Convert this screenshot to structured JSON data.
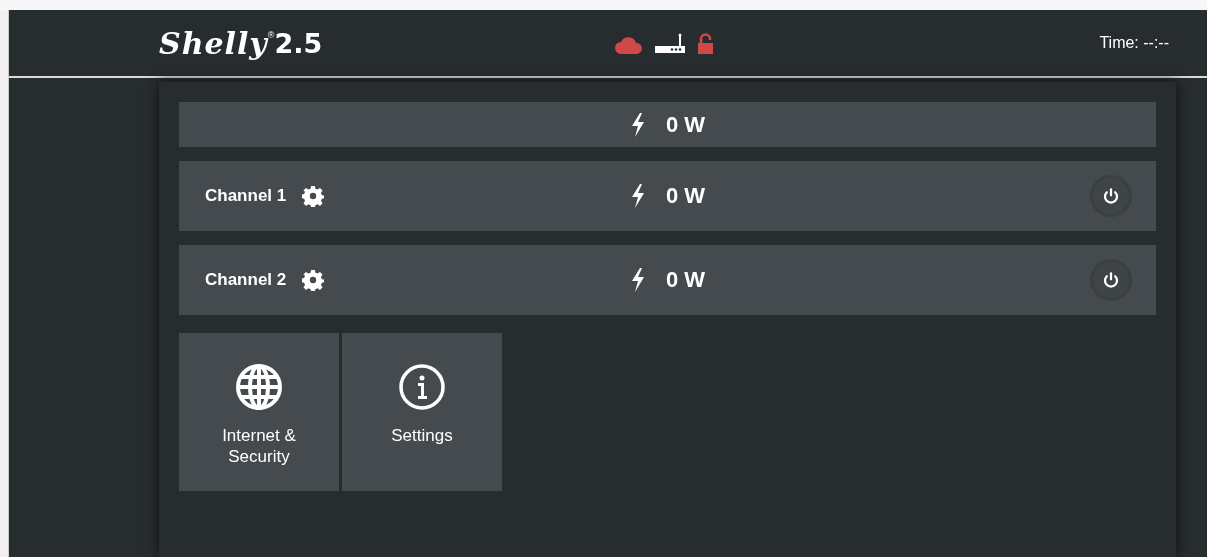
{
  "header": {
    "logo": {
      "brand": "Shelly",
      "mark": "®",
      "model": "2.5"
    },
    "status_icons": [
      {
        "kind": "cloud",
        "on": false
      },
      {
        "kind": "router",
        "on": true
      },
      {
        "kind": "lock",
        "on": false
      }
    ],
    "time": "Time: --:--"
  },
  "total": {
    "power": "0 W"
  },
  "channels": [
    {
      "name": "Channel 1",
      "power": "0 W"
    },
    {
      "name": "Channel 2",
      "power": "0 W"
    }
  ],
  "tiles": [
    {
      "kind": "globe",
      "label": "Internet & Security"
    },
    {
      "kind": "info",
      "label": "Settings"
    }
  ]
}
